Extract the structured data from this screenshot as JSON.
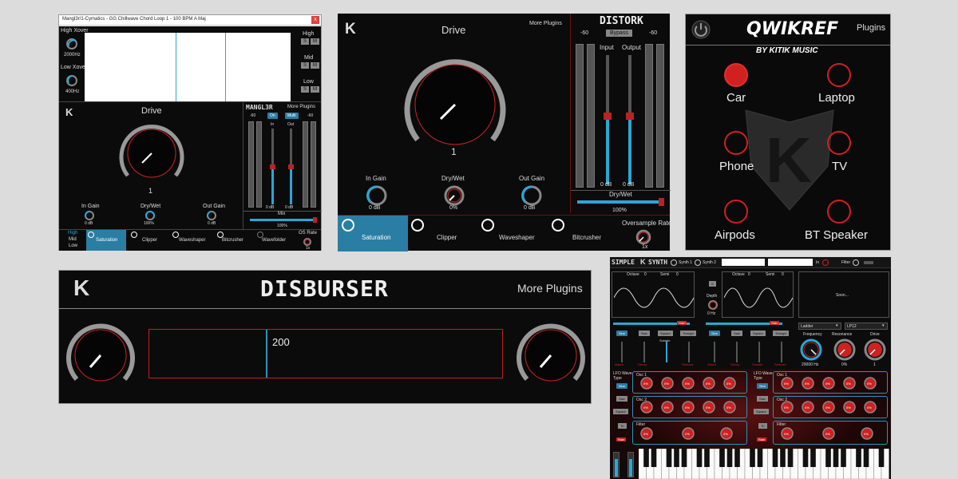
{
  "manglr": {
    "title_bar": "Mangl3r/1-Cymatics - GG Chillwave Chord Loop 1 - 100 BPM A Maj",
    "close": "x",
    "high_xover": "High Xover",
    "high_freq": "2000Hz",
    "low_xover": "Low Xover",
    "low_freq": "400Hz",
    "band_labels": [
      "High",
      "Mid",
      "Low"
    ],
    "band_btn": "S",
    "band_btn2": "M",
    "drive_label": "Drive",
    "drive_value": "1",
    "logo": "MANGL3R",
    "more_plugins": "More Plugins",
    "meter_min": "-60",
    "bypass": "On",
    "bypass2": "Multi",
    "in": "In",
    "out": "Out",
    "db": "0 dB",
    "mix": "Mix",
    "mix_value": "100%",
    "knobs": [
      {
        "label": "In Gain",
        "value": "0 dB"
      },
      {
        "label": "Dry/Wet",
        "value": "100%"
      },
      {
        "label": "Out Gain",
        "value": "0 dB"
      }
    ],
    "bands": [
      "High",
      "Mid",
      "Low"
    ],
    "tabs": [
      "Saturation",
      "Clipper",
      "Waveshaper",
      "Bitcrusher",
      "Wavefolder"
    ],
    "os_rate": "OS Rate",
    "os_value": "1x"
  },
  "distork": {
    "drive_label": "Drive",
    "drive_value": "1",
    "more_plugins": "More Plugins",
    "logo": "DISTORK",
    "meter_min": "-60",
    "bypass": "Bypass",
    "input": "Input",
    "output": "Output",
    "db": "0 dB",
    "drywet": "Dry/Wet",
    "drywet_value": "100%",
    "knobs": [
      {
        "label": "In Gain",
        "value": "0 dB"
      },
      {
        "label": "Dry/Wet",
        "value": "0%"
      },
      {
        "label": "Out Gain",
        "value": "0 dB"
      }
    ],
    "tabs": [
      "Saturation",
      "Clipper",
      "Waveshaper",
      "Bitcrusher"
    ],
    "oversample": "Oversample Rate",
    "oversample_value": "1x"
  },
  "qwikref": {
    "title": "QWIKREF",
    "subtitle": "BY KITIK MUSIC",
    "plugins": "Plugins",
    "buttons": [
      "Car",
      "Laptop",
      "Phone",
      "TV",
      "Airpods",
      "BT Speaker"
    ],
    "active_index": 0
  },
  "disburser": {
    "title": "DISBURSER",
    "more_plugins": "More Plugins",
    "value": "200"
  },
  "synth": {
    "logo_a": "SIMPLE",
    "logo_b": "SYNTH",
    "synth1": "Synth 1",
    "synth2": "Synth 2",
    "in": "In",
    "filter": "Filter",
    "octave": "Octave",
    "octave_val": "0",
    "semi": "Semi",
    "semi_val": "0",
    "depth": "Depth",
    "depth_val": "0 Hz",
    "soon": "Soon...",
    "gain": "Gain",
    "waves": [
      "Sine",
      "Saw",
      "Square",
      "Triangle"
    ],
    "adsr": [
      "Attack",
      "Decay",
      "Sustain",
      "Release"
    ],
    "ladder": "Ladder",
    "lp": "LP12",
    "frequency": "Frequency",
    "resonance": "Resonance",
    "drive": "Drive",
    "freq_val": "20000 Hz",
    "res_val": "0%",
    "drive_val": "1",
    "lfo_wave": "LFO Wave Type",
    "lfo_opts": [
      "Sine",
      "Saw",
      "Square",
      "Tri",
      "Rate"
    ],
    "osc1": "Osc 1",
    "osc2": "Osc 2",
    "filter_label": "Filter",
    "pct": "0%"
  }
}
